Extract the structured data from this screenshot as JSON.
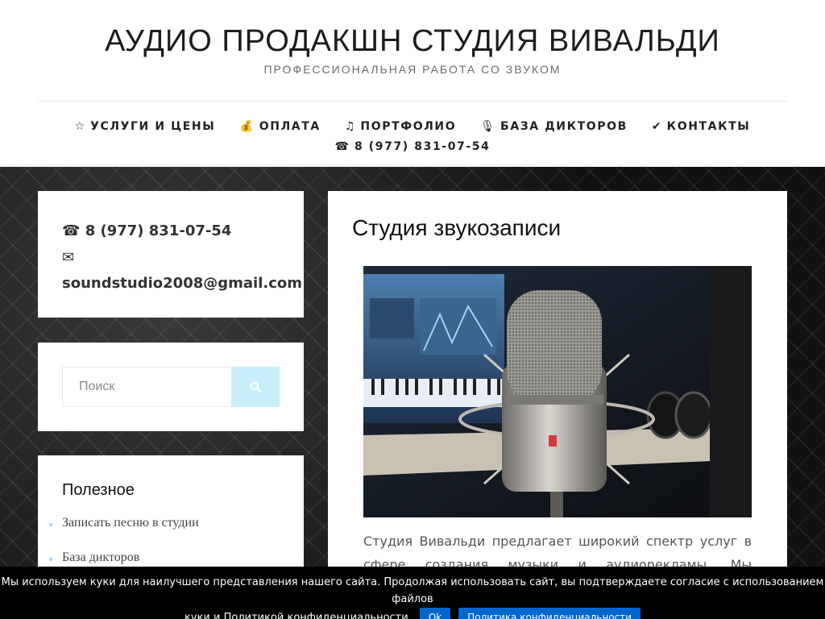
{
  "header": {
    "title": "АУДИО ПРОДАКШН СТУДИЯ ВИВАЛЬДИ",
    "description": "ПРОФЕССИОНАЛЬНАЯ РАБОТА СО ЗВУКОМ"
  },
  "nav": {
    "items": [
      {
        "icon": "☆",
        "label": "УСЛУГИ И ЦЕНЫ"
      },
      {
        "icon": "💰",
        "label": "ОПЛАТА"
      },
      {
        "icon": "♫",
        "label": "ПОРТФОЛИО"
      },
      {
        "icon": "🎙",
        "label": "БАЗА ДИКТОРОВ"
      },
      {
        "icon": "✔",
        "label": "КОНТАКТЫ"
      }
    ],
    "phone": {
      "icon": "☎",
      "label": "8 (977) 831-07-54"
    }
  },
  "sidebar": {
    "contact": {
      "phone_icon": "☎",
      "phone": "8 (977) 831-07-54",
      "email_icon": "✉",
      "email": "soundstudio2008@gmail.com"
    },
    "search": {
      "placeholder": "Поиск"
    },
    "useful": {
      "title": "Полезное",
      "links": [
        "Записать песню в студии",
        "База дикторов"
      ]
    }
  },
  "main": {
    "title": "Студия звукозаписи",
    "text": "Студия Вивальди предлагает широкий спектр услуг в сфере создания музыки и аудиорекламы. Мы занимаемся"
  },
  "cookie": {
    "text_line1": "Мы используем куки для наилучшего представления нашего сайта. Продолжая использовать сайт, вы подтверждаете согласие с использованием файлов",
    "text_line2": "куки и Политикой конфиденциальности.",
    "ok_label": "Ok",
    "policy_label": "Политика конфиденциальности"
  },
  "colors": {
    "accent": "#c9eefa",
    "bullet": "#9adff5",
    "cookie_button": "#0066cc"
  }
}
